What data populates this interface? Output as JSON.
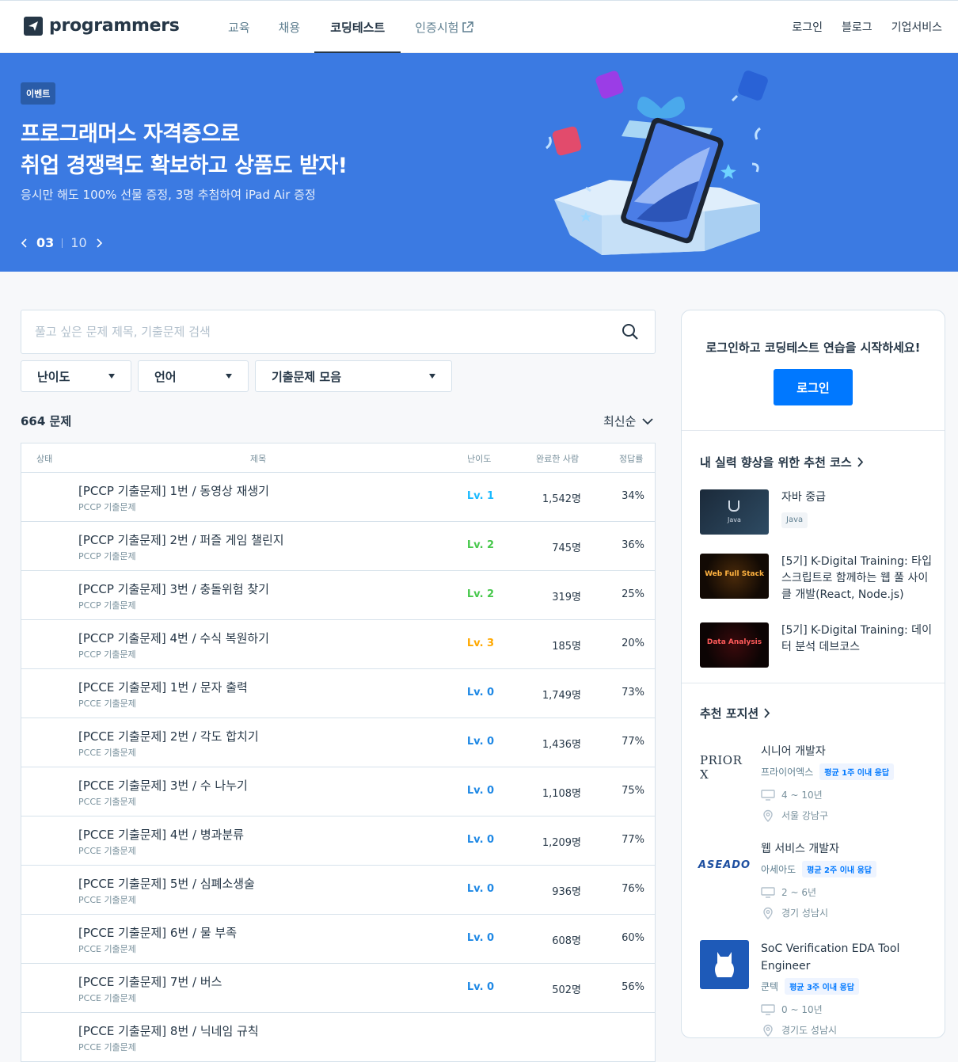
{
  "header": {
    "logo_text": "programmers",
    "nav": [
      "교육",
      "채용",
      "코딩테스트",
      "인증시험"
    ],
    "nav_active": "코딩테스트",
    "right": [
      "로그인",
      "블로그",
      "기업서비스"
    ]
  },
  "banner": {
    "badge": "이벤트",
    "title_line1": "프로그래머스 자격증으로",
    "title_line2": "취업 경쟁력도 확보하고 상품도 받자!",
    "subtitle": "응시만 해도 100% 선물 증정, 3명 추첨하여 iPad Air 증정",
    "page_current": "03",
    "page_total": "10",
    "bg_color": "#3b7ae2"
  },
  "search": {
    "placeholder": "풀고 싶은 문제 제목, 기출문제 검색"
  },
  "filters": {
    "difficulty": "난이도",
    "language": "언어",
    "collection": "기출문제 모음"
  },
  "list": {
    "count": "664 문제",
    "sort": "최신순",
    "columns": [
      "상태",
      "제목",
      "난이도",
      "완료한 사람",
      "정답률"
    ],
    "rows": [
      {
        "title": "[PCCP 기출문제] 1번 / 동영상 재생기",
        "part": "PCCP 기출문제",
        "level": "Lv. 1",
        "completed": "1,542명",
        "rate": "34%"
      },
      {
        "title": "[PCCP 기출문제] 2번 / 퍼즐 게임 챌린지",
        "part": "PCCP 기출문제",
        "level": "Lv. 2",
        "completed": "745명",
        "rate": "36%"
      },
      {
        "title": "[PCCP 기출문제] 3번 / 충돌위험 찾기",
        "part": "PCCP 기출문제",
        "level": "Lv. 2",
        "completed": "319명",
        "rate": "25%"
      },
      {
        "title": "[PCCP 기출문제] 4번 / 수식 복원하기",
        "part": "PCCP 기출문제",
        "level": "Lv. 3",
        "completed": "185명",
        "rate": "20%"
      },
      {
        "title": "[PCCE 기출문제] 1번 / 문자 출력",
        "part": "PCCE 기출문제",
        "level": "Lv. 0",
        "completed": "1,749명",
        "rate": "73%"
      },
      {
        "title": "[PCCE 기출문제] 2번 / 각도 합치기",
        "part": "PCCE 기출문제",
        "level": "Lv. 0",
        "completed": "1,436명",
        "rate": "77%"
      },
      {
        "title": "[PCCE 기출문제] 3번 / 수 나누기",
        "part": "PCCE 기출문제",
        "level": "Lv. 0",
        "completed": "1,108명",
        "rate": "75%"
      },
      {
        "title": "[PCCE 기출문제] 4번 / 병과분류",
        "part": "PCCE 기출문제",
        "level": "Lv. 0",
        "completed": "1,209명",
        "rate": "77%"
      },
      {
        "title": "[PCCE 기출문제] 5번 / 심폐소생술",
        "part": "PCCE 기출문제",
        "level": "Lv. 0",
        "completed": "936명",
        "rate": "76%"
      },
      {
        "title": "[PCCE 기출문제] 6번 / 물 부족",
        "part": "PCCE 기출문제",
        "level": "Lv. 0",
        "completed": "608명",
        "rate": "60%"
      },
      {
        "title": "[PCCE 기출문제] 7번 / 버스",
        "part": "PCCE 기출문제",
        "level": "Lv. 0",
        "completed": "502명",
        "rate": "56%"
      },
      {
        "title": "[PCCE 기출문제] 8번 / 닉네임 규칙",
        "part": "PCCE 기출문제",
        "level": "",
        "completed": "",
        "rate": ""
      }
    ],
    "level_colors": {
      "Lv. 0": "#1e88e5",
      "Lv. 1": "#1bbaff",
      "Lv. 2": "#47c84c",
      "Lv. 3": "#ffa800"
    }
  },
  "sidebar": {
    "login_message": "로그인하고 코딩테스트 연습을 시작하세요!",
    "login_button": "로그인",
    "courses_title": "내 실력 향상을 위한 추천 코스",
    "courses": [
      {
        "title": "자바 중급",
        "tag": "Java",
        "thumb_text": "Java"
      },
      {
        "title": "[5기] K-Digital Training: 타입스크립트로 함께하는 웹 풀 사이클 개발(React, Node.js)",
        "tag": "",
        "thumb_text": "Web Full Stack"
      },
      {
        "title": "[5기] K-Digital Training: 데이터 분석 데브코스",
        "tag": "",
        "thumb_text": "Data Analysis"
      }
    ],
    "positions_title": "추천 포지션",
    "positions": [
      {
        "logo": "PRIOR X",
        "title": "시니어 개발자",
        "company": "프라이어엑스",
        "badge": "평균 1주 이내 응답",
        "career": "4 ~ 10년",
        "location": "서울 강남구"
      },
      {
        "logo": "ASEADO",
        "title": "웹 서비스 개발자",
        "company": "아세아도",
        "badge": "평균 2주 이내 응답",
        "career": "2 ~ 6년",
        "location": "경기 성남시"
      },
      {
        "logo": "",
        "title": "SoC Verification EDA Tool Engineer",
        "company": "쿤텍",
        "badge": "평균 3주 이내 응답",
        "career": "0 ~ 10년",
        "location": "경기도 성남시"
      }
    ]
  }
}
